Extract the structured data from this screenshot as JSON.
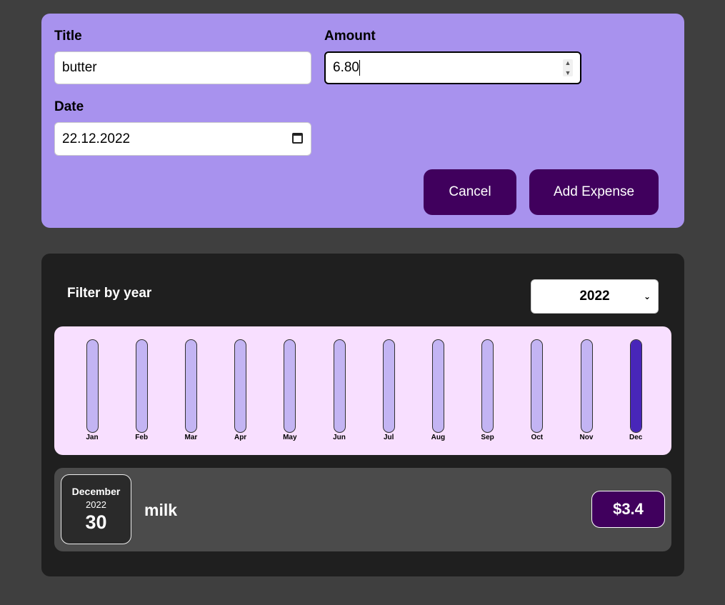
{
  "form": {
    "title_label": "Title",
    "title_value": "butter",
    "amount_label": "Amount",
    "amount_value": "6.80",
    "date_label": "Date",
    "date_value": "22.12.2022",
    "cancel_label": "Cancel",
    "add_label": "Add Expense"
  },
  "filter": {
    "label": "Filter by year",
    "selected_year": "2022"
  },
  "chart_data": {
    "type": "bar",
    "categories": [
      "Jan",
      "Feb",
      "Mar",
      "Apr",
      "May",
      "Jun",
      "Jul",
      "Aug",
      "Sep",
      "Oct",
      "Nov",
      "Dec"
    ],
    "values": [
      0,
      0,
      0,
      0,
      0,
      0,
      0,
      0,
      0,
      0,
      0,
      1
    ],
    "ylim": [
      0,
      1
    ]
  },
  "expenses": [
    {
      "month": "December",
      "year": "2022",
      "day": "30",
      "title": "milk",
      "amount": "$3.4"
    }
  ],
  "colors": {
    "form_bg": "#a892ee",
    "button": "#40005d",
    "chart_bg": "#f8dfff",
    "bar_empty": "#c3b4f3",
    "bar_fill": "#4826b9"
  }
}
